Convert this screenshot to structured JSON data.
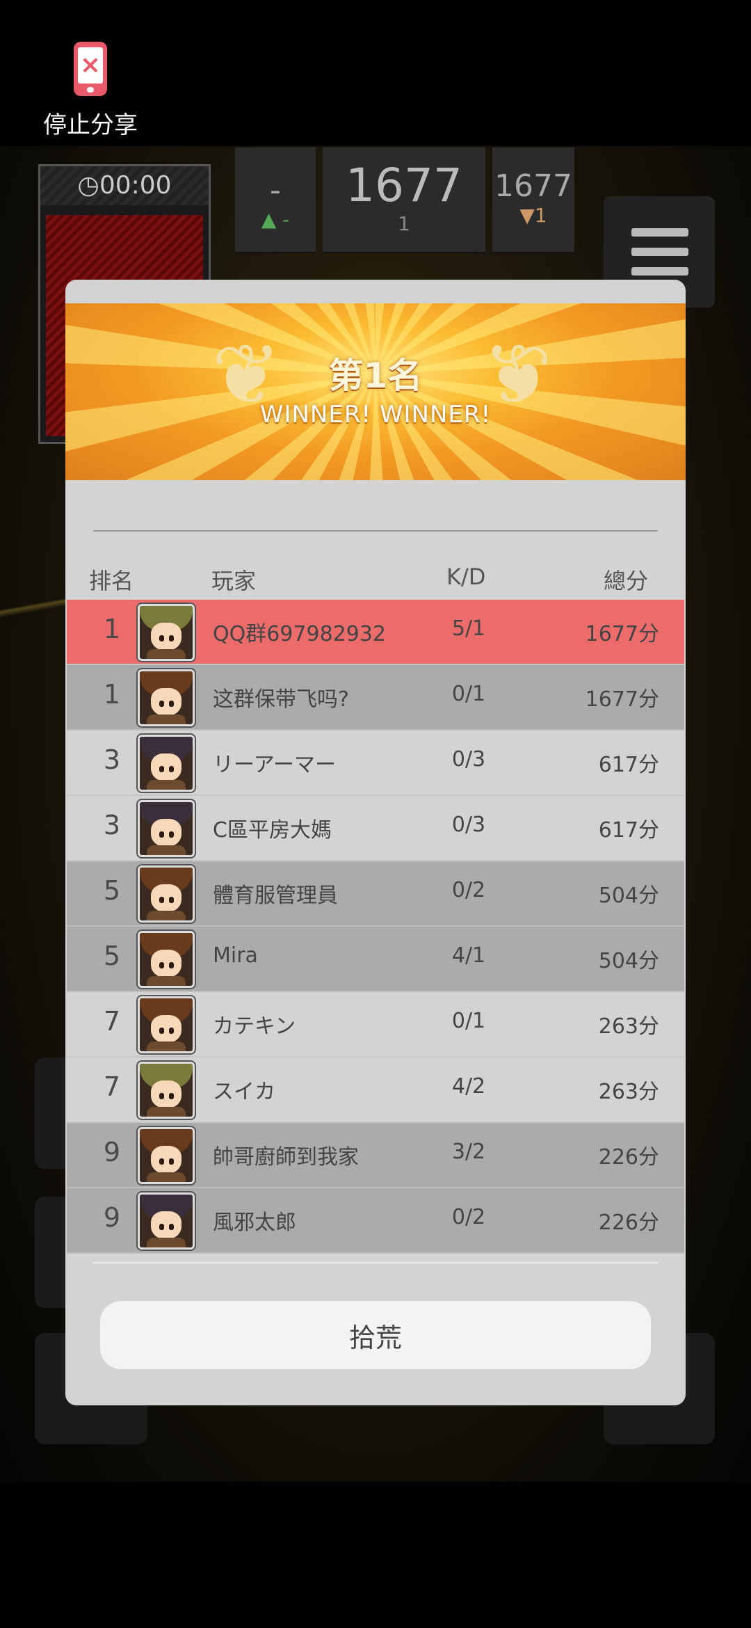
{
  "share": {
    "icon": "phone-stop-share-icon",
    "label": "停止分享",
    "icon_glyph": "×",
    "icon_color": "#e85a6a"
  },
  "hud": {
    "timer": "◷00:00",
    "left_top": "-",
    "left_sub": "▲ -",
    "center_score": "1677",
    "center_sub": "1",
    "right_score": "1677",
    "right_sub": "▼1"
  },
  "dialog": {
    "rank_title": "第1名",
    "subtitle": "WINNER! WINNER!",
    "laurel_glyph": "❦",
    "headers": {
      "rank": "排名",
      "player": "玩家",
      "kd": "K/D",
      "score": "總分"
    },
    "players": [
      {
        "rank": "1",
        "name": "QQ群697982932",
        "kd": "5/1",
        "score": "1677分",
        "style": "me",
        "hair": "#7a7a3a"
      },
      {
        "rank": "1",
        "name": "这群保带飞吗?",
        "kd": "0/1",
        "score": "1677分",
        "style": "dark",
        "hair": "#6a3a1c"
      },
      {
        "rank": "3",
        "name": "リーアーマー",
        "kd": "0/3",
        "score": "617分",
        "style": "light",
        "hair": "#3a2e3a"
      },
      {
        "rank": "3",
        "name": "C區平房大媽",
        "kd": "0/3",
        "score": "617分",
        "style": "light",
        "hair": "#3a2e3a"
      },
      {
        "rank": "5",
        "name": "體育服管理員",
        "kd": "0/2",
        "score": "504分",
        "style": "dark",
        "hair": "#6a3a1c"
      },
      {
        "rank": "5",
        "name": "Mira",
        "kd": "4/1",
        "score": "504分",
        "style": "dark",
        "hair": "#6a3a1c"
      },
      {
        "rank": "7",
        "name": "カテキン",
        "kd": "0/1",
        "score": "263分",
        "style": "light",
        "hair": "#6a3a1c"
      },
      {
        "rank": "7",
        "name": "スイカ",
        "kd": "4/2",
        "score": "263分",
        "style": "light",
        "hair": "#7a7a3a"
      },
      {
        "rank": "9",
        "name": "帥哥廚師到我家",
        "kd": "3/2",
        "score": "226分",
        "style": "dark",
        "hair": "#6a3a1c"
      },
      {
        "rank": "9",
        "name": "風邪太郎",
        "kd": "0/2",
        "score": "226分",
        "style": "dark",
        "hair": "#3a2e3a"
      }
    ],
    "action_label": "拾荒"
  },
  "colors": {
    "highlight_row": "#ec6b6b",
    "dark_row": "#ababab",
    "light_row": "#d3d3d3",
    "banner_orange": "#f29a22"
  }
}
